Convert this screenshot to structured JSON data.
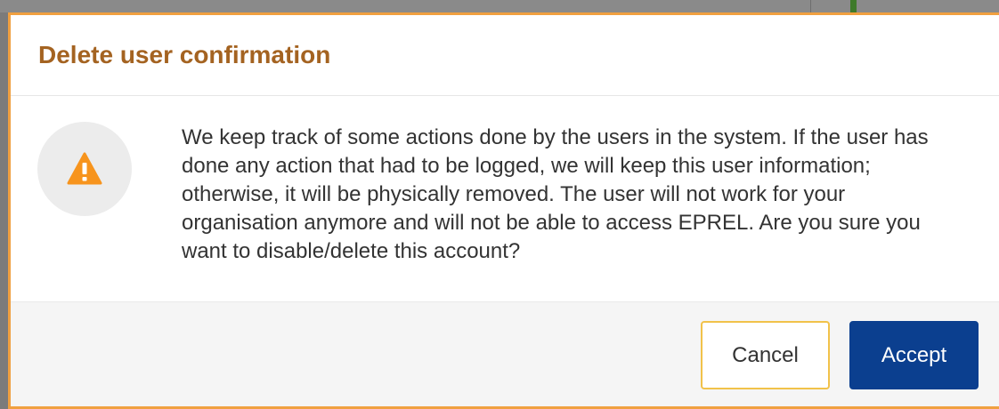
{
  "dialog": {
    "title": "Delete user confirmation",
    "icon": "warning-icon",
    "message": "We keep track of some actions done by the users in the system. If the user has done any action that had to be logged, we will keep this user information; otherwise, it will be physically removed. The user will not work for your organisation anymore and will not be able to access EPREL. Are you sure you want to disable/delete this account?",
    "buttons": {
      "cancel_label": "Cancel",
      "accept_label": "Accept"
    }
  },
  "colors": {
    "title": "#a46321",
    "warning_icon": "#f7941d",
    "accept_button": "#0b3f8f",
    "cancel_border": "#f1c24a",
    "dialog_border": "#f0a040"
  }
}
